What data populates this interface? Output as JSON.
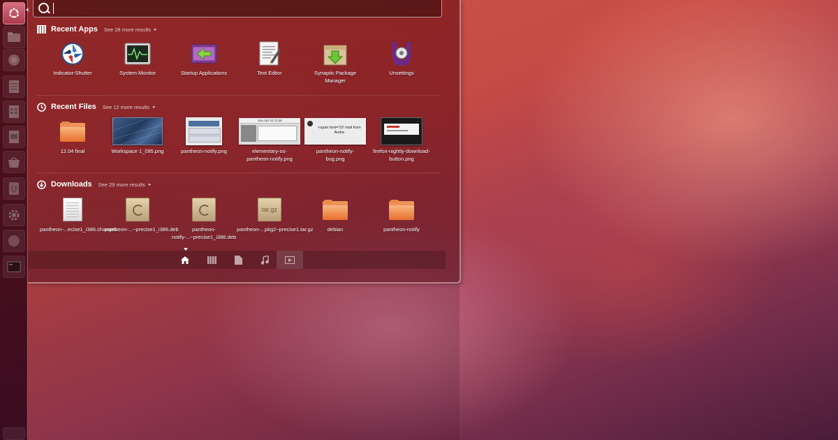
{
  "dash": {
    "search": {
      "value": "",
      "placeholder": ""
    },
    "sections": [
      {
        "title": "Recent Apps",
        "more": "See 28 more results",
        "items": [
          {
            "label": "Indicator-Shutter",
            "icon": "shutter-icon"
          },
          {
            "label": "System Monitor",
            "icon": "system-monitor-icon"
          },
          {
            "label": "Startup Applications",
            "icon": "startup-applications-icon"
          },
          {
            "label": "Text Editor",
            "icon": "text-editor-icon"
          },
          {
            "label": "Synaptic Package Manager",
            "icon": "synaptic-icon"
          },
          {
            "label": "Unsettings",
            "icon": "unsettings-icon"
          }
        ]
      },
      {
        "title": "Recent Files",
        "more": "See 12 more results",
        "items": [
          {
            "label": "12.04 final",
            "icon": "folder-icon"
          },
          {
            "label": "Workspace 1_095.png",
            "icon": "image-thumbnail"
          },
          {
            "label": "pantheon-notify.png",
            "icon": "image-thumbnail"
          },
          {
            "label": "elementary-os-pantheon-notify.png",
            "icon": "image-thumbnail",
            "thumb_text": "Sun Apr 22 12:36"
          },
          {
            "label": "pantheon-notify-bug.png",
            "icon": "image-thumbnail",
            "thumb_text": "<span font='10' mail from Andre"
          },
          {
            "label": "firefox-nightly-download-button.png",
            "icon": "image-thumbnail"
          }
        ]
      },
      {
        "title": "Downloads",
        "more": "See 29 more results",
        "items": [
          {
            "label": "pantheon-...ecise1_i386.changes",
            "icon": "text-document-icon"
          },
          {
            "label": "pantheon-...~precise1_i386.deb",
            "icon": "deb-package-icon"
          },
          {
            "label": "pantheon-notify-...~precise1_i386.deb",
            "icon": "deb-package-icon"
          },
          {
            "label": "pantheon-...pkg2~precise1.tar.gz",
            "icon": "tar-archive-icon",
            "pkg_text": "tar.gz"
          },
          {
            "label": "debian",
            "icon": "folder-icon"
          },
          {
            "label": "pantheon-notify",
            "icon": "folder-icon"
          }
        ]
      }
    ],
    "filters": [
      "home-lens-icon",
      "applications-lens-icon",
      "files-lens-icon",
      "music-lens-icon",
      "video-lens-icon"
    ],
    "active_filter": "video-lens-icon",
    "more_arrow": "▸"
  },
  "launcher": {
    "items": [
      "ubuntu-logo-icon",
      "home-folder-icon",
      "firefox-icon",
      "writer-icon",
      "calc-icon",
      "impress-icon",
      "software-center-icon",
      "ubuntu-one-icon",
      "system-settings-icon",
      "workspace-switcher-icon",
      "terminal-icon",
      "trash-icon"
    ]
  },
  "colors": {
    "folder": "#e76f2e",
    "accent": "#a93a4c"
  }
}
